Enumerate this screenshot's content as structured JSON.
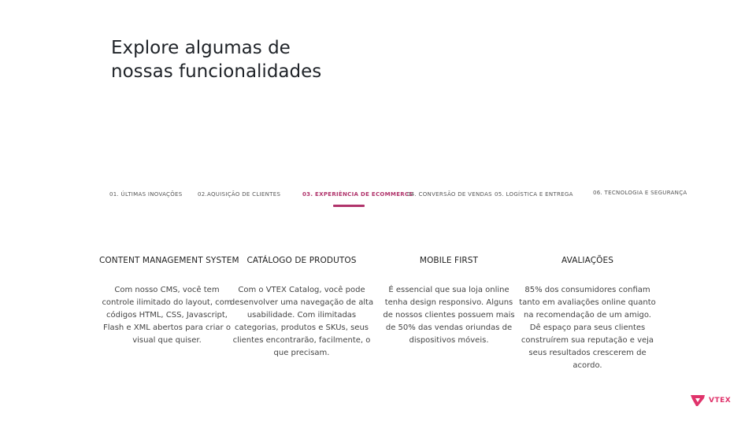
{
  "header": {
    "title_line1": "Explore algumas de",
    "title_line2": "nossas funcionalidades"
  },
  "tabs": [
    {
      "label": "01. ÚLTIMAS INOVAÇÕES",
      "active": false
    },
    {
      "label": "02.AQUISIÇÃO DE CLIENTES",
      "active": false
    },
    {
      "label": "03. EXPERIÊNCIA DE ECOMMERCE",
      "active": true
    },
    {
      "label": "04. CONVERSÃO DE VENDAS",
      "active": false
    },
    {
      "label": "05. LOGÍSTICA E ENTREGA",
      "active": false
    },
    {
      "label": "06. TECNOLOGIA E SEGURANÇA",
      "active": false
    }
  ],
  "features": [
    {
      "title": "CONTENT MANAGEMENT SYSTEM",
      "description": "Com nosso CMS, você tem controle ilimitado do layout, com códigos HTML, CSS, Javascript, Flash e XML abertos para criar o visual que quiser."
    },
    {
      "title": "CATÁLOGO DE PRODUTOS",
      "description": "Com o VTEX Catalog, você pode desenvolver uma navegação de alta usabilidade. Com ilimitadas categorias, produtos e SKUs, seus clientes encontrarão, facilmente, o que precisam."
    },
    {
      "title": "MOBILE FIRST",
      "description": "É essencial que sua loja online tenha design responsivo. Alguns de nossos clientes possuem mais de 50% das vendas oriundas de dispositivos móveis."
    },
    {
      "title": "AVALIAÇÕES",
      "description": "85% dos consumidores confiam tanto em avaliações online quanto na recomendação de um amigo. Dê espaço para seus clientes construírem sua reputação e veja seus resultados crescerem de acordo."
    }
  ],
  "logo": {
    "text": "VTEX",
    "icon": "vtex-logo-icon"
  },
  "colors": {
    "accent": "#b0336b",
    "brand": "#e0336b"
  }
}
